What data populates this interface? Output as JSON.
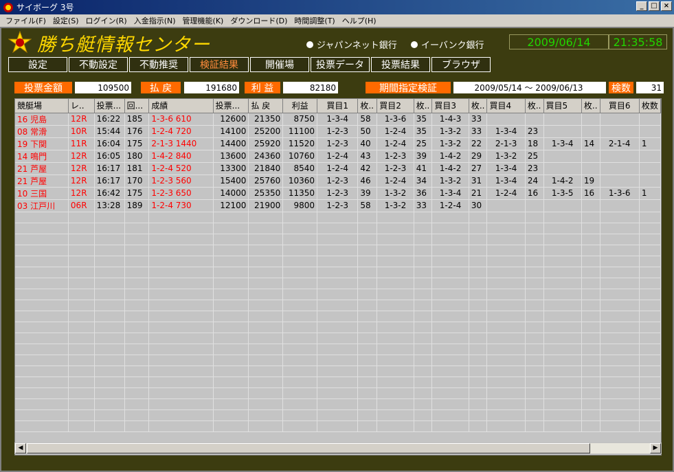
{
  "window": {
    "title": "サイボーグ 3号"
  },
  "menu": [
    "ファイル(F)",
    "設定(S)",
    "ログイン(R)",
    "入金指示(N)",
    "管理機能(K)",
    "ダウンロード(D)",
    "時間調整(T)",
    "ヘルプ(H)"
  ],
  "app": {
    "title": "勝ち艇情報センター"
  },
  "banks": [
    "ジャパンネット銀行",
    "イーバンク銀行"
  ],
  "clock": {
    "date": "2009/06/14",
    "time": "21:35:58"
  },
  "nav": [
    {
      "label": "設定"
    },
    {
      "label": "不動設定"
    },
    {
      "label": "不動推奨"
    },
    {
      "label": "検証結果",
      "active": true
    },
    {
      "label": "開催場"
    },
    {
      "label": "投票データ"
    },
    {
      "label": "投票結果"
    },
    {
      "label": "ブラウザ"
    }
  ],
  "summary": {
    "bet_label": "投票金額",
    "bet_value": "109500",
    "payout_label": "払 戻",
    "payout_value": "191680",
    "profit_label": "利 益",
    "profit_value": "82180",
    "period_label": "期間指定検証",
    "period_value": "2009/05/14 ～ 2009/06/13",
    "count_label": "検数",
    "count_value": "31"
  },
  "grid": {
    "headers": [
      "競艇場",
      "レ..",
      "投票...",
      "回...",
      "成績",
      "投票...",
      "払 戻",
      "利益",
      "買目1",
      "枚..",
      "買目2",
      "枚..",
      "買目3",
      "枚..",
      "買目4",
      "枚..",
      "買目5",
      "枚..",
      "買目6",
      "枚数"
    ],
    "rows": [
      [
        "16 児島",
        "12R",
        "16:22",
        "185",
        "1-3-6  610",
        "12600",
        "21350",
        "8750",
        "1-3-4",
        "58",
        "1-3-6",
        "35",
        "1-4-3",
        "33",
        "",
        "",
        "",
        "",
        "",
        ""
      ],
      [
        "08 常滑",
        "10R",
        "15:44",
        "176",
        "1-2-4  720",
        "14100",
        "25200",
        "11100",
        "1-2-3",
        "50",
        "1-2-4",
        "35",
        "1-3-2",
        "33",
        "1-3-4",
        "23",
        "",
        "",
        "",
        ""
      ],
      [
        "19 下関",
        "11R",
        "16:04",
        "175",
        "2-1-3  1440",
        "14400",
        "25920",
        "11520",
        "1-2-3",
        "40",
        "1-2-4",
        "25",
        "1-3-2",
        "22",
        "2-1-3",
        "18",
        "1-3-4",
        "14",
        "2-1-4",
        "1"
      ],
      [
        "14 鳴門",
        "12R",
        "16:05",
        "180",
        "1-4-2  840",
        "13600",
        "24360",
        "10760",
        "1-2-4",
        "43",
        "1-2-3",
        "39",
        "1-4-2",
        "29",
        "1-3-2",
        "25",
        "",
        "",
        "",
        ""
      ],
      [
        "21 芦屋",
        "12R",
        "16:17",
        "181",
        "1-2-4  520",
        "13300",
        "21840",
        "8540",
        "1-2-4",
        "42",
        "1-2-3",
        "41",
        "1-4-2",
        "27",
        "1-3-4",
        "23",
        "",
        "",
        "",
        ""
      ],
      [
        "21 芦屋",
        "12R",
        "16:17",
        "170",
        "1-2-3  560",
        "15400",
        "25760",
        "10360",
        "1-2-3",
        "46",
        "1-2-4",
        "34",
        "1-3-2",
        "31",
        "1-3-4",
        "24",
        "1-4-2",
        "19",
        "",
        ""
      ],
      [
        "10 三国",
        "12R",
        "16:42",
        "175",
        "1-2-3  650",
        "14000",
        "25350",
        "11350",
        "1-2-3",
        "39",
        "1-3-2",
        "36",
        "1-3-4",
        "21",
        "1-2-4",
        "16",
        "1-3-5",
        "16",
        "1-3-6",
        "1"
      ],
      [
        "03 江戸川",
        "06R",
        "13:28",
        "189",
        "1-2-4  730",
        "12100",
        "21900",
        "9800",
        "1-2-3",
        "58",
        "1-3-2",
        "33",
        "1-2-4",
        "30",
        "",
        "",
        "",
        "",
        "",
        ""
      ]
    ]
  }
}
